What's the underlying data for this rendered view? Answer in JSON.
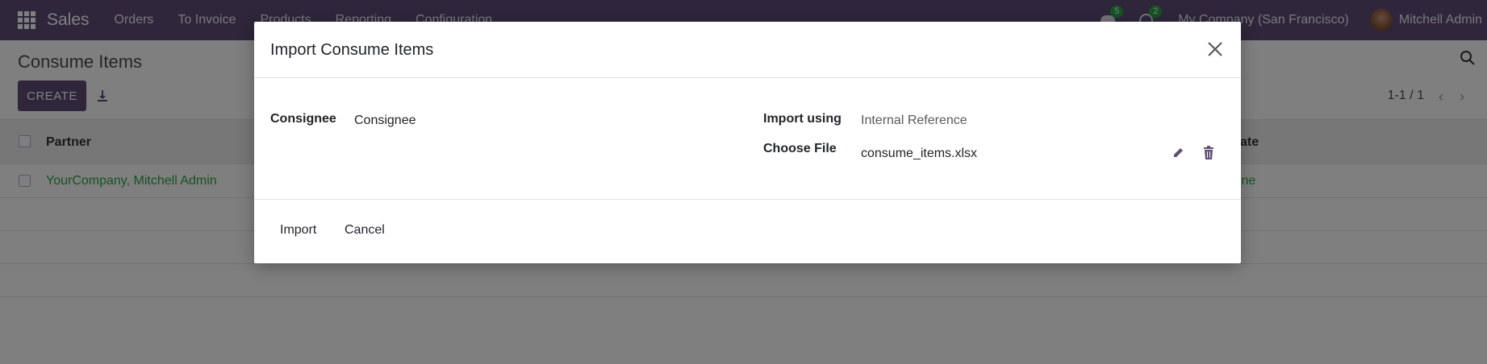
{
  "navbar": {
    "brand": "Sales",
    "menu": [
      "Orders",
      "To Invoice",
      "Products",
      "Reporting",
      "Configuration"
    ],
    "messages_count": "5",
    "activities_count": "2",
    "company": "My Company (San Francisco)",
    "user": "Mitchell Admin"
  },
  "control_panel": {
    "title": "Consume Items",
    "create_label": "CREATE",
    "pager": "1-1 / 1"
  },
  "list": {
    "columns": {
      "partner": "Partner",
      "state": "State"
    },
    "rows": [
      {
        "partner": "YourCompany, Mitchell Admin",
        "state": "Done"
      }
    ]
  },
  "modal": {
    "title": "Import Consume Items",
    "consignee_label": "Consignee",
    "consignee_value": "Consignee",
    "import_using_label": "Import using",
    "import_using_value": "Internal Reference",
    "choose_file_label": "Choose File",
    "file_name": "consume_items.xlsx",
    "import_label": "Import",
    "cancel_label": "Cancel"
  },
  "colors": {
    "navbar": "#5e4d77",
    "primary": "#5e4d77",
    "success": "#28a745",
    "backdrop": "rgba(0,0,0,0.5)"
  },
  "icons": [
    "apps-grid-icon",
    "chat-icon",
    "clock-icon",
    "download-icon",
    "search-icon",
    "chevron-left-icon",
    "chevron-right-icon",
    "close-icon",
    "pencil-icon",
    "trash-icon"
  ]
}
